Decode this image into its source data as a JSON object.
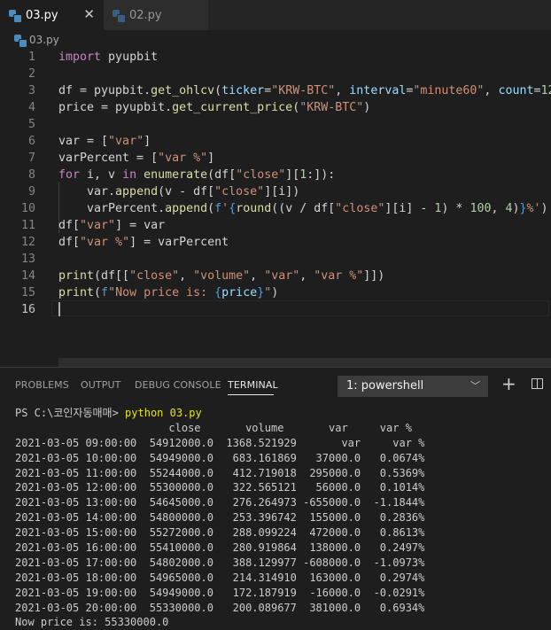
{
  "tabs": [
    {
      "label": "03.py",
      "active": true
    },
    {
      "label": "02.py",
      "active": false
    }
  ],
  "close_glyph": "✕",
  "breadcrumb": "03.py",
  "line_numbers": [
    "1",
    "2",
    "3",
    "4",
    "5",
    "6",
    "7",
    "8",
    "9",
    "10",
    "11",
    "12",
    "13",
    "14",
    "15",
    "16"
  ],
  "code": {
    "l1_import": "import",
    "l1_mod": " pyupbit",
    "l3_a": "df = pyupbit.",
    "l3_fn": "get_ohlcv",
    "l3_p1": "ticker",
    "l3_s1": "\"KRW-BTC\"",
    "l3_p2": "interval",
    "l3_s2": "\"minute60\"",
    "l3_p3": "count",
    "l3_n1": "12",
    "l4_a": "price = pyupbit.",
    "l4_fn": "get_current_price",
    "l4_s1": "\"KRW-BTC\"",
    "l6_a": "var = [",
    "l6_s1": "\"var\"",
    "l6_b": "]",
    "l7_a": "varPercent = [",
    "l7_s1": "\"var %\"",
    "l7_b": "]",
    "l8_for": "for",
    "l8_a": " i, v ",
    "l8_in": "in",
    "l8_fn": "enumerate",
    "l8_b": "(df[",
    "l8_s1": "\"close\"",
    "l8_c": "][",
    "l8_n1": "1",
    "l8_d": ":]):",
    "l9_a": "    var.",
    "l9_fn": "append",
    "l9_b": "(v - df[",
    "l9_s1": "\"close\"",
    "l9_c": "][i])",
    "l10_a": "    varPercent.",
    "l10_fn": "append",
    "l10_b": "(",
    "l10_f": "f",
    "l10_s1": "'",
    "l10_br1": "{",
    "l10_fn2": "round",
    "l10_c": "((v / df[",
    "l10_s2": "\"close\"",
    "l10_d": "][i] - ",
    "l10_n1": "1",
    "l10_e": ") * ",
    "l10_n2": "100",
    "l10_f2": ", ",
    "l10_n3": "4",
    "l10_g": ")",
    "l10_br2": "}",
    "l10_s3": "%'",
    "l10_h": ")",
    "l11_a": "df[",
    "l11_s1": "\"var\"",
    "l11_b": "] = var",
    "l12_a": "df[",
    "l12_s1": "\"var %\"",
    "l12_b": "] = varPercent",
    "l14_fn": "print",
    "l14_a": "(df[[",
    "l14_s1": "\"close\"",
    "l14_s2": "\"volume\"",
    "l14_s3": "\"var\"",
    "l14_s4": "\"var %\"",
    "l14_b": "]])",
    "l15_fn": "print",
    "l15_a": "(",
    "l15_f": "f",
    "l15_s1": "\"Now price is: ",
    "l15_br1": "{",
    "l15_v": "price",
    "l15_br2": "}",
    "l15_s2": "\"",
    "l15_b": ")"
  },
  "panel": {
    "tabs": [
      "PROBLEMS",
      "OUTPUT",
      "DEBUG CONSOLE",
      "TERMINAL"
    ],
    "terminal_select": "1: powershell",
    "chevron": "﹀",
    "plus": "+"
  },
  "terminal": {
    "prompt": "PS C:\\코인자동매매> ",
    "command": "python 03.py",
    "lines": [
      "                        close       volume       var     var %",
      "2021-03-05 09:00:00  54912000.0  1368.521929       var     var %",
      "2021-03-05 10:00:00  54949000.0   683.161869   37000.0   0.0674%",
      "2021-03-05 11:00:00  55244000.0   412.719018  295000.0   0.5369%",
      "2021-03-05 12:00:00  55300000.0   322.565121   56000.0   0.1014%",
      "2021-03-05 13:00:00  54645000.0   276.264973 -655000.0  -1.1844%",
      "2021-03-05 14:00:00  54800000.0   253.396742  155000.0   0.2836%",
      "2021-03-05 15:00:00  55272000.0   288.099224  472000.0   0.8613%",
      "2021-03-05 16:00:00  55410000.0   280.919864  138000.0   0.2497%",
      "2021-03-05 17:00:00  54802000.0   388.129977 -608000.0  -1.0973%",
      "2021-03-05 18:00:00  54965000.0   214.314910  163000.0   0.2974%",
      "2021-03-05 19:00:00  54949000.0   172.187919  -16000.0  -0.0291%",
      "2021-03-05 20:00:00  55330000.0   200.089677  381000.0   0.6934%",
      "Now price is: 55330000.0"
    ]
  }
}
